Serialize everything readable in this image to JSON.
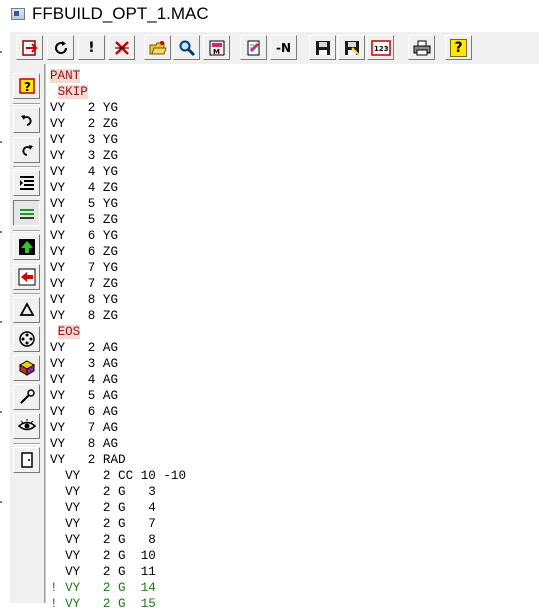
{
  "window": {
    "title": "FFBUILD_OPT_1.MAC"
  },
  "toolbar": {
    "buttons": [
      {
        "name": "export-icon"
      },
      {
        "name": "refresh-icon"
      },
      {
        "name": "exclamation-icon",
        "glyph": "!"
      },
      {
        "name": "cancel-x-icon"
      },
      {
        "name": "open-folder-icon"
      },
      {
        "name": "search-icon"
      },
      {
        "name": "macro-icon"
      },
      {
        "name": "edit-icon"
      },
      {
        "name": "minus-n-icon",
        "glyph": "-N"
      },
      {
        "name": "save-icon"
      },
      {
        "name": "save-as-icon"
      },
      {
        "name": "numbers-icon",
        "glyph": "123"
      },
      {
        "name": "print-icon"
      },
      {
        "name": "help-icon",
        "glyph": "?"
      }
    ]
  },
  "sidebar": {
    "buttons": [
      {
        "name": "context-help-icon"
      },
      {
        "name": "undo-icon"
      },
      {
        "name": "redo-icon"
      },
      {
        "name": "indent-icon"
      },
      {
        "name": "lines-icon"
      },
      {
        "name": "green-arrow-up-icon"
      },
      {
        "name": "red-arrow-left-icon"
      },
      {
        "name": "triangle-icon"
      },
      {
        "name": "target-icon"
      },
      {
        "name": "cube-icon"
      },
      {
        "name": "wrench-icon"
      },
      {
        "name": "eye-icon"
      },
      {
        "name": "exit-door-icon"
      }
    ]
  },
  "code": {
    "lines": [
      {
        "text": "PANT",
        "type": "cmd"
      },
      {
        "text": " SKIP",
        "type": "cmd"
      },
      {
        "text": "VY   2 YG",
        "type": "normal"
      },
      {
        "text": "VY   2 ZG",
        "type": "normal"
      },
      {
        "text": "VY   3 YG",
        "type": "normal"
      },
      {
        "text": "VY   3 ZG",
        "type": "normal"
      },
      {
        "text": "VY   4 YG",
        "type": "normal"
      },
      {
        "text": "VY   4 ZG",
        "type": "normal"
      },
      {
        "text": "VY   5 YG",
        "type": "normal"
      },
      {
        "text": "VY   5 ZG",
        "type": "normal"
      },
      {
        "text": "VY   6 YG",
        "type": "normal"
      },
      {
        "text": "VY   6 ZG",
        "type": "normal"
      },
      {
        "text": "VY   7 YG",
        "type": "normal"
      },
      {
        "text": "VY   7 ZG",
        "type": "normal"
      },
      {
        "text": "VY   8 YG",
        "type": "normal"
      },
      {
        "text": "VY   8 ZG",
        "type": "normal"
      },
      {
        "text": " EOS",
        "type": "cmd"
      },
      {
        "text": "VY   2 AG",
        "type": "normal"
      },
      {
        "text": "VY   3 AG",
        "type": "normal"
      },
      {
        "text": "VY   4 AG",
        "type": "normal"
      },
      {
        "text": "VY   5 AG",
        "type": "normal"
      },
      {
        "text": "VY   6 AG",
        "type": "normal"
      },
      {
        "text": "VY   7 AG",
        "type": "normal"
      },
      {
        "text": "VY   8 AG",
        "type": "normal"
      },
      {
        "text": "VY   2 RAD",
        "type": "normal"
      },
      {
        "text": "  VY   2 CC 10 -10",
        "type": "normal"
      },
      {
        "text": "  VY   2 G   3",
        "type": "normal"
      },
      {
        "text": "  VY   2 G   4",
        "type": "normal"
      },
      {
        "text": "  VY   2 G   7",
        "type": "normal"
      },
      {
        "text": "  VY   2 G   8",
        "type": "normal"
      },
      {
        "text": "  VY   2 G  10",
        "type": "normal"
      },
      {
        "text": "  VY   2 G  11",
        "type": "normal"
      },
      {
        "text": "! VY   2 G  14",
        "type": "comment"
      },
      {
        "text": "! VY   2 G  15",
        "type": "comment"
      }
    ]
  },
  "colors": {
    "cmd_highlight_bg": "#f3d9d2",
    "cmd_text": "#8b1a1a",
    "comment_text": "#1a7a1a"
  }
}
